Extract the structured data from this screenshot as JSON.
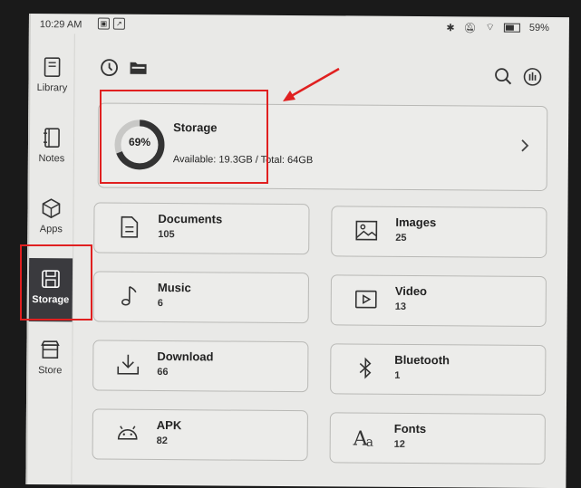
{
  "status_bar": {
    "time": "10:29 AM",
    "battery": "59%",
    "battery_fraction": 0.59
  },
  "sidebar": {
    "items": [
      {
        "label": "Library",
        "icon": "book-icon"
      },
      {
        "label": "Notes",
        "icon": "notebook-icon"
      },
      {
        "label": "Apps",
        "icon": "cube-icon"
      },
      {
        "label": "Storage",
        "icon": "floppy-disk-icon",
        "active": true
      },
      {
        "label": "Store",
        "icon": "shop-icon"
      }
    ]
  },
  "toolbar": {
    "left_icons": [
      "clock-icon",
      "folder-icon"
    ],
    "right_icons": [
      "search-icon",
      "storage-analysis-icon"
    ]
  },
  "storage": {
    "title": "Storage",
    "percent_label": "69%",
    "used_fraction": 0.69,
    "detail": "Available: 19.3GB / Total: 64GB"
  },
  "categories": [
    {
      "name": "Documents",
      "count": "105",
      "icon": "document-icon"
    },
    {
      "name": "Images",
      "count": "25",
      "icon": "image-icon"
    },
    {
      "name": "Music",
      "count": "6",
      "icon": "music-note-icon"
    },
    {
      "name": "Video",
      "count": "13",
      "icon": "video-play-icon"
    },
    {
      "name": "Download",
      "count": "66",
      "icon": "download-icon"
    },
    {
      "name": "Bluetooth",
      "count": "1",
      "icon": "bluetooth-icon"
    },
    {
      "name": "APK",
      "count": "82",
      "icon": "android-icon"
    },
    {
      "name": "Fonts",
      "count": "12",
      "icon": "font-icon"
    }
  ],
  "annotations": {
    "color": "#e02020"
  }
}
